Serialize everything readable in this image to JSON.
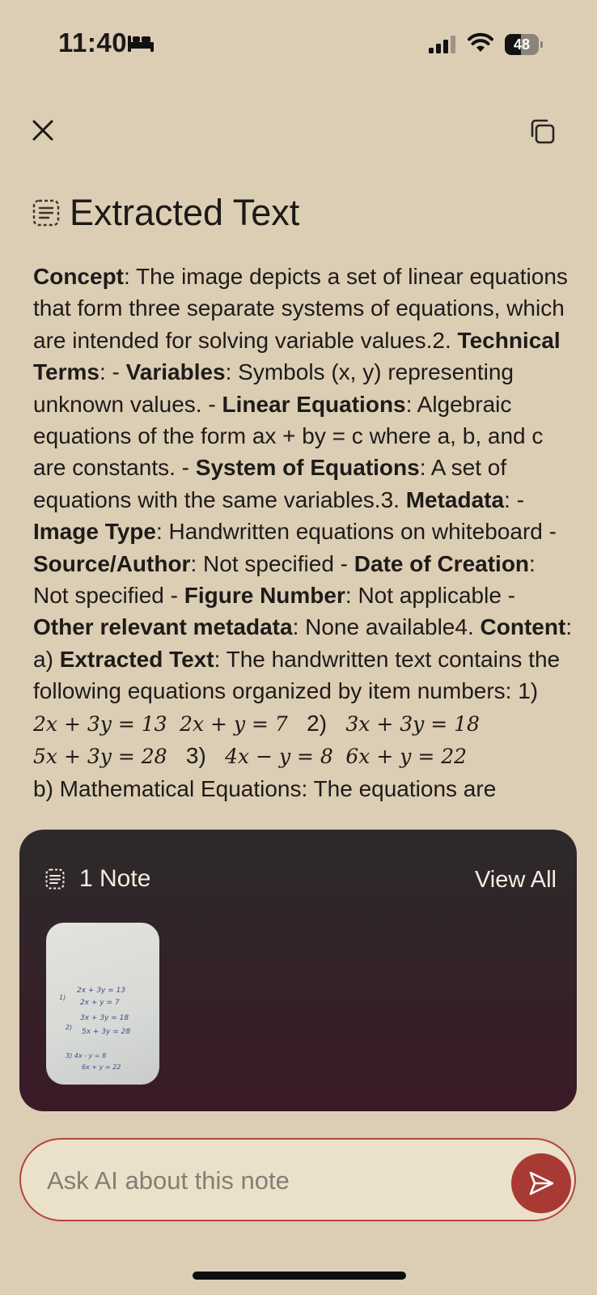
{
  "status_bar": {
    "time": "11:40",
    "battery_percent": 48,
    "battery_label": "48",
    "focus_icon": "bed-icon",
    "signal_icon": "cellular-signal-icon",
    "wifi_icon": "wifi-icon"
  },
  "header": {
    "close_icon": "close-icon",
    "copy_icon": "copy-icon",
    "title_icon": "document-text-icon",
    "title": "Extracted Text"
  },
  "content": {
    "concept_label": "Concept",
    "concept_text": ":   The image depicts a set of linear equations that form three separate systems of equations, which are intended for solving variable values.2. ",
    "technical_terms_label": "Technical Terms",
    "technical_terms_sep": ":   - ",
    "variables_label": "Variables",
    "variables_text": ": Symbols (x, y) representing unknown values.   - ",
    "linear_equations_label": "Linear Equations",
    "linear_equations_text": ": Algebraic equations of the form ax + by = c where a, b, and c are constants.   - ",
    "system_label": "System of Equations",
    "system_text": ": A set of equations with the same variables.3. ",
    "metadata_label": "Metadata",
    "metadata_sep": ":   - ",
    "image_type_label": "Image Type",
    "image_type_text": ": Handwritten equations on whiteboard   - ",
    "source_label": "Source/Author",
    "source_text": ": Not specified   - ",
    "date_label": "Date of Creation",
    "date_text": ": Not specified   - ",
    "figure_label": "Figure Number",
    "figure_text": ": Not applicable   - ",
    "other_label": "Other relevant metadata",
    "other_text": ": None available4. ",
    "content_label": "Content",
    "content_sep": ":   a) ",
    "extracted_label": "Extracted Text",
    "extracted_text": ":     The handwritten text contains the following equations organized by item numbers:   1)",
    "eq_1a": "2x + 3y = 13",
    "eq_1b": "2x + y = 7",
    "item_2": "2)",
    "eq_2a": "3x + 3y = 18",
    "eq_2b": "5x + 3y = 28",
    "item_3": "3)",
    "eq_3a": "4x − y = 8",
    "eq_3b": "6x + y = 22",
    "cut_line": "   b) Mathematical Equations: The equations are"
  },
  "notes": {
    "icon": "document-text-icon",
    "count_label": "1 Note",
    "view_all": "View All",
    "thumbnail": {
      "lines": [
        "1)",
        "2x + 3y = 13",
        "2x + y = 7",
        "2)",
        "3x + 3y = 18",
        "5x + 3y = 28",
        "3) 4x - y = 8",
        "6x + y = 22"
      ]
    }
  },
  "ask": {
    "placeholder": "Ask AI about this note",
    "send_icon": "send-icon",
    "accent_color": "#a83a33"
  },
  "colors": {
    "background": "#dccdb5",
    "panel_top": "#2c2a2b",
    "panel_bottom": "#3a1a27",
    "text": "#1c1a18"
  }
}
